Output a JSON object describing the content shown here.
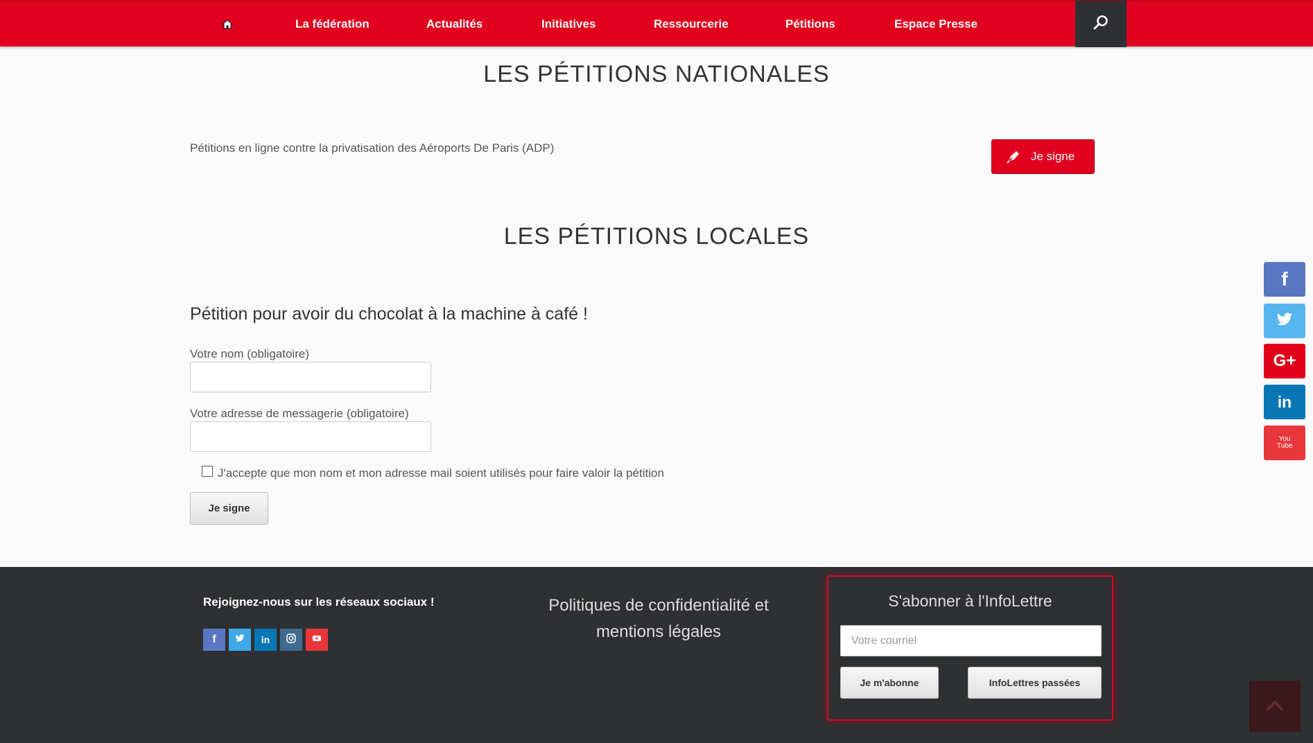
{
  "nav": {
    "home_icon": "home-icon",
    "items": [
      "La fédération",
      "Actualités",
      "Initiatives",
      "Ressourcerie",
      "Pétitions",
      "Espace Presse"
    ],
    "search_icon": "search-icon"
  },
  "national": {
    "title": "LES PÉTITIONS NATIONALES",
    "petition_text": "Pétitions en ligne contre la privatisation des Aéroports De Paris (ADP)",
    "sign_button": "Je signe",
    "sign_icon": "pen-icon"
  },
  "local": {
    "title": "LES PÉTITIONS LOCALES",
    "petition_title": "Pétition pour avoir du chocolat à la machine à café !",
    "name_label": "Votre nom (obligatoire)",
    "name_value": "",
    "email_label": "Votre adresse de messagerie (obligatoire)",
    "email_value": "",
    "consent_label": "J'accepte que mon nom et mon adresse mail soient utilisés pour faire valoir la pétition",
    "consent_checked": false,
    "submit_button": "Je signe"
  },
  "side_social": [
    {
      "name": "facebook",
      "glyph": "f",
      "color": "#5b77c4"
    },
    {
      "name": "twitter",
      "glyph": "t",
      "color": "#55b5ee"
    },
    {
      "name": "google-plus",
      "glyph": "G+",
      "color": "#e0001a"
    },
    {
      "name": "linkedin",
      "glyph": "in",
      "color": "#0a77b5"
    },
    {
      "name": "youtube",
      "glyph": "You Tube",
      "color": "#e8373a"
    }
  ],
  "footer": {
    "social_heading": "Rejoignez-nous sur les réseaux sociaux !",
    "social": [
      {
        "name": "facebook",
        "glyph": "f",
        "color": "#5b77c4"
      },
      {
        "name": "twitter",
        "glyph": "t",
        "color": "#3fa9e8"
      },
      {
        "name": "linkedin",
        "glyph": "in",
        "color": "#0a77b5"
      },
      {
        "name": "instagram",
        "glyph": "◎",
        "color": "#3e6b8e"
      },
      {
        "name": "youtube",
        "glyph": "▶",
        "color": "#e8373a"
      }
    ],
    "legal_link": "Politiques de confidentialité et mentions légales",
    "newsletter": {
      "title": "S'abonner à l'InfoLettre",
      "email_placeholder": "Votre courriel",
      "subscribe_button": "Je m'abonne",
      "archive_button": "InfoLettres passées"
    },
    "back_to_top_icon": "chevron-up-icon"
  },
  "colors": {
    "brand_red": "#e1001e",
    "dark": "#2f3033"
  }
}
